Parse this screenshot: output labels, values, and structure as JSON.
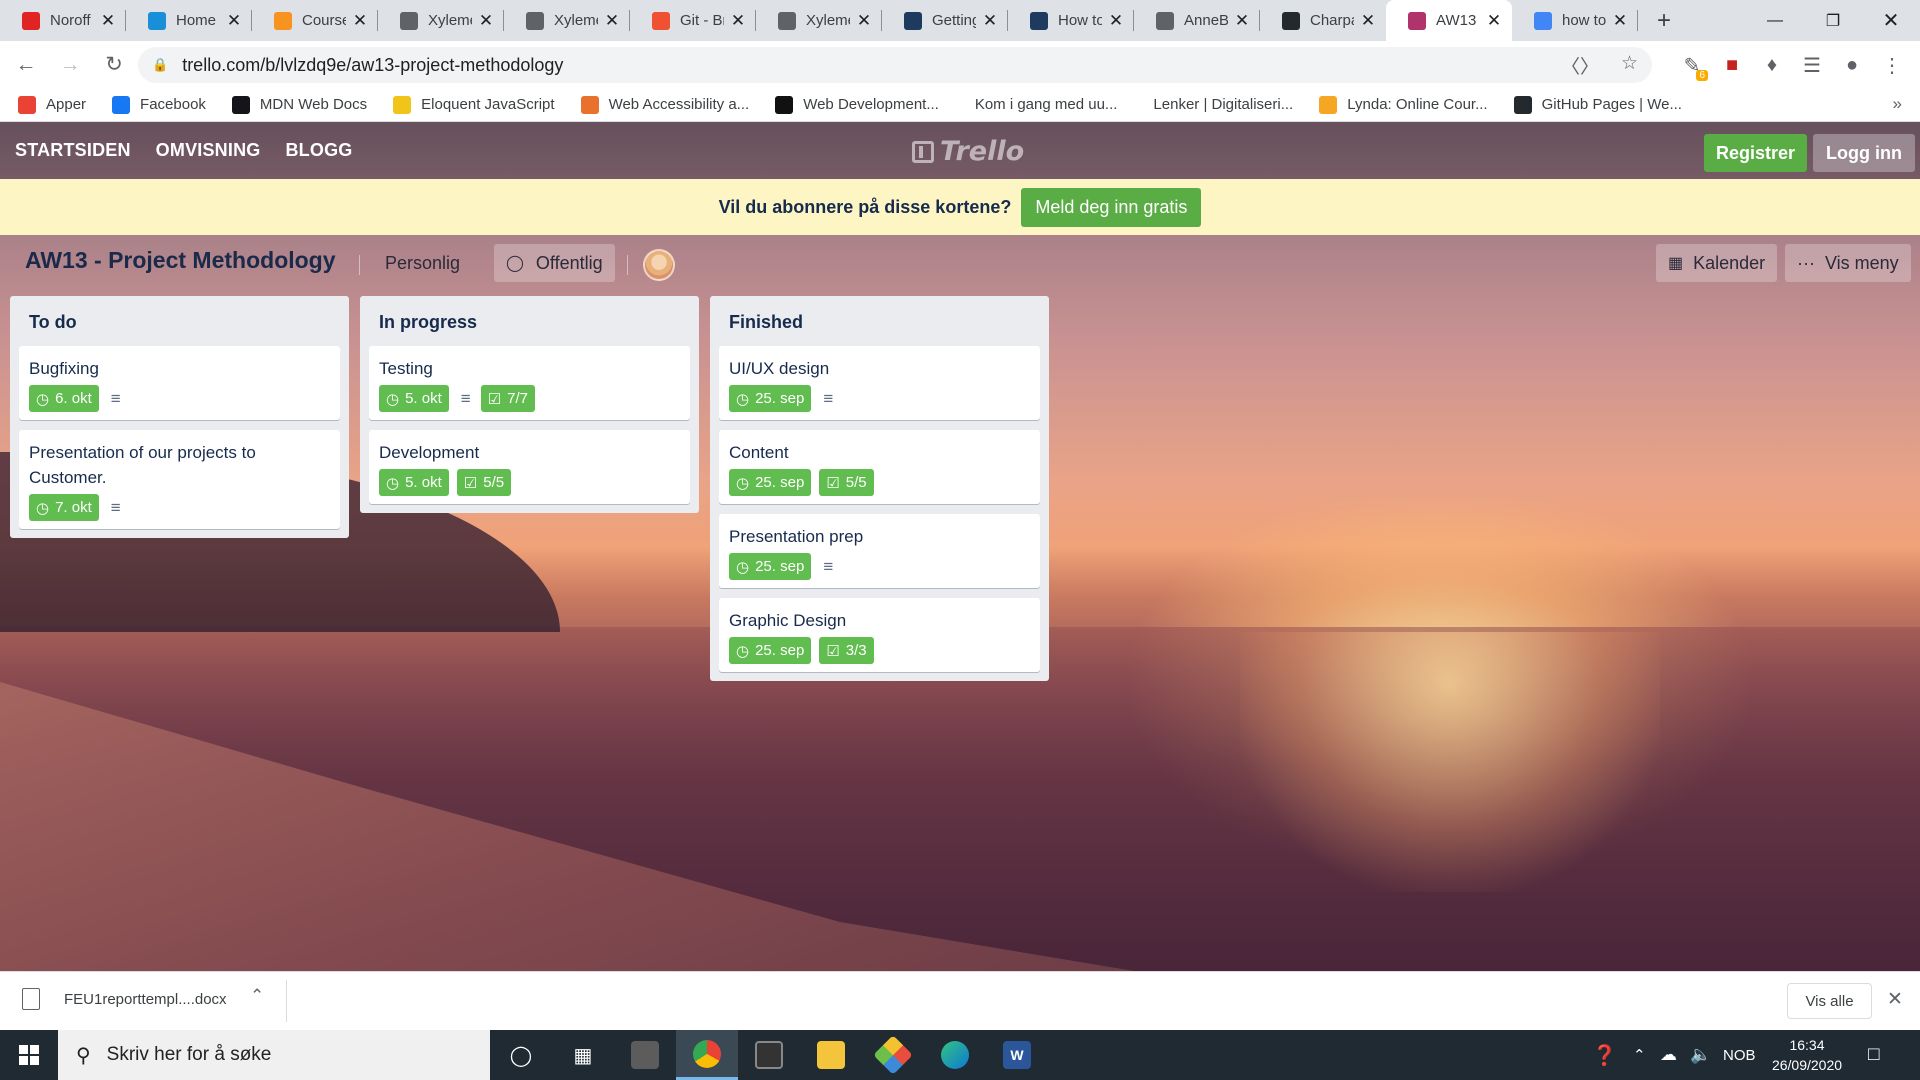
{
  "browser": {
    "tabs": [
      {
        "title": "Noroff",
        "icon": "noroff-icon",
        "color": "#e02424"
      },
      {
        "title": "Home",
        "icon": "cloud-icon",
        "color": "#1a8fd9"
      },
      {
        "title": "Course",
        "icon": "moodle-icon",
        "color": "#f7931e"
      },
      {
        "title": "Xyleme",
        "icon": "globe-icon",
        "color": "#5f6368"
      },
      {
        "title": "Xyleme",
        "icon": "globe-icon",
        "color": "#5f6368"
      },
      {
        "title": "Git - Br",
        "icon": "git-icon",
        "color": "#f05133"
      },
      {
        "title": "Xyleme",
        "icon": "globe-icon",
        "color": "#5f6368"
      },
      {
        "title": "Getting",
        "icon": "tdn-icon",
        "color": "#1f3a5f"
      },
      {
        "title": "How to",
        "icon": "tdn-icon",
        "color": "#1f3a5f"
      },
      {
        "title": "AnneB",
        "icon": "globe-icon",
        "color": "#5f6368"
      },
      {
        "title": "Charpa",
        "icon": "github-icon",
        "color": "#24292e"
      },
      {
        "title": "AW13",
        "icon": "trello-icon",
        "color": "#b0336c",
        "active": true
      },
      {
        "title": "how to",
        "icon": "google-icon",
        "color": "#4285f4"
      }
    ],
    "url": "trello.com/b/lvlzdq9e/aw13-project-methodology",
    "extension_badge": "6",
    "bookmarks": [
      {
        "label": "Apper",
        "icon": "apps-grid-icon",
        "color": "#ea4335"
      },
      {
        "label": "Facebook",
        "icon": "facebook-icon",
        "color": "#1877f2"
      },
      {
        "label": "MDN Web Docs",
        "icon": "mdn-icon",
        "color": "#15141a"
      },
      {
        "label": "Eloquent JavaScript",
        "icon": "ejs-icon",
        "color": "#f0c419"
      },
      {
        "label": "Web Accessibility a...",
        "icon": "chevron-right-icon",
        "color": "#e8712e"
      },
      {
        "label": "Web Development...",
        "icon": "medium-icon",
        "color": "#111111"
      },
      {
        "label": "Kom i gang med uu...",
        "icon": "blank-icon",
        "color": "#ffffff"
      },
      {
        "label": "Lenker | Digitaliseri...",
        "icon": "blank-icon",
        "color": "#ffffff"
      },
      {
        "label": "Lynda: Online Cour...",
        "icon": "lynda-icon",
        "color": "#f5a623"
      },
      {
        "label": "GitHub Pages | We...",
        "icon": "github-icon",
        "color": "#24292e"
      }
    ]
  },
  "trello": {
    "nav": [
      "STARTSIDEN",
      "OMVISNING",
      "BLOGG"
    ],
    "logo": "Trello",
    "register_label": "Registrer",
    "login_label": "Logg inn",
    "banner_text": "Vil du abonnere på disse kortene?",
    "banner_cta": "Meld deg inn gratis",
    "board": {
      "title": "AW13 - Project Methodology",
      "team_label": "Personlig",
      "visibility_label": "Offentlig",
      "calendar_label": "Kalender",
      "menu_label": "Vis meny"
    },
    "accent_green": "#61bd4f",
    "lists": [
      {
        "title": "To do",
        "cards": [
          {
            "title": "Bugfixing",
            "due": "6. okt",
            "description": true
          },
          {
            "title": "Presentation of our projects to Customer.",
            "due": "7. okt",
            "description": true
          }
        ]
      },
      {
        "title": "In progress",
        "cards": [
          {
            "title": "Testing",
            "due": "5. okt",
            "description": true,
            "checklist": "7/7"
          },
          {
            "title": "Development",
            "due": "5. okt",
            "checklist": "5/5"
          }
        ]
      },
      {
        "title": "Finished",
        "cards": [
          {
            "title": "UI/UX design",
            "due": "25. sep",
            "description": true
          },
          {
            "title": "Content",
            "due": "25. sep",
            "checklist": "5/5"
          },
          {
            "title": "Presentation prep",
            "due": "25. sep",
            "description": true
          },
          {
            "title": "Graphic Design",
            "due": "25. sep",
            "checklist": "3/3"
          }
        ]
      }
    ]
  },
  "downloads": {
    "file": "FEU1reporttempl....docx",
    "show_all": "Vis alle"
  },
  "taskbar": {
    "search_placeholder": "Skriv her for å søke",
    "language": "NOB",
    "time": "16:34",
    "date": "26/09/2020"
  }
}
